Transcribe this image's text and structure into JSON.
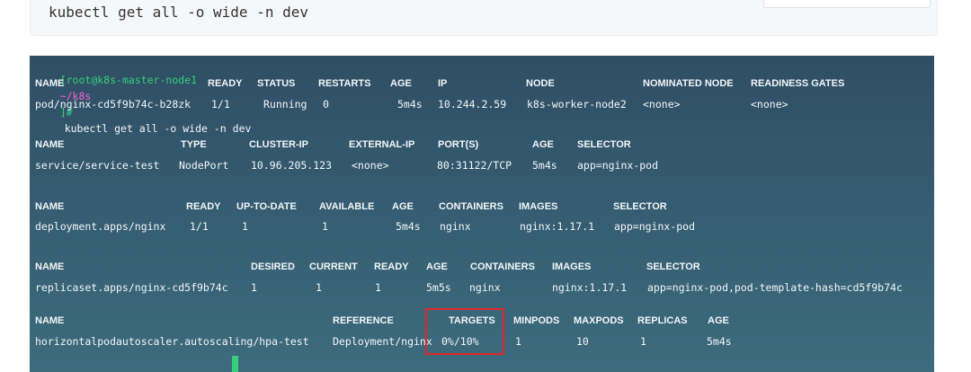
{
  "code": {
    "command": "kubectl get all -o wide -n dev"
  },
  "prompt": {
    "user_host": "[root@k8s-master-node1",
    "dir": "~/k8s",
    "suffix": "]#",
    "command": "kubectl get all -o wide -n dev"
  },
  "pods": {
    "headers": [
      "NAME",
      "READY",
      "STATUS",
      "RESTARTS",
      "AGE",
      "IP",
      "NODE",
      "NOMINATED NODE",
      "READINESS GATES"
    ],
    "rows": [
      [
        "pod/nginx-cd5f9b74c-b28zk",
        "1/1",
        "Running",
        "0",
        "5m4s",
        "10.244.2.59",
        "k8s-worker-node2",
        "<none>",
        "<none>"
      ]
    ]
  },
  "services": {
    "headers": [
      "NAME",
      "TYPE",
      "CLUSTER-IP",
      "EXTERNAL-IP",
      "PORT(S)",
      "AGE",
      "SELECTOR"
    ],
    "rows": [
      [
        "service/service-test",
        "NodePort",
        "10.96.205.123",
        "<none>",
        "80:31122/TCP",
        "5m4s",
        "app=nginx-pod"
      ]
    ]
  },
  "deployments": {
    "headers": [
      "NAME",
      "READY",
      "UP-TO-DATE",
      "AVAILABLE",
      "AGE",
      "CONTAINERS",
      "IMAGES",
      "SELECTOR"
    ],
    "rows": [
      [
        "deployment.apps/nginx",
        "1/1",
        "1",
        "1",
        "5m4s",
        "nginx",
        "nginx:1.17.1",
        "app=nginx-pod"
      ]
    ]
  },
  "replicasets": {
    "headers": [
      "NAME",
      "DESIRED",
      "CURRENT",
      "READY",
      "AGE",
      "CONTAINERS",
      "IMAGES",
      "SELECTOR"
    ],
    "rows": [
      [
        "replicaset.apps/nginx-cd5f9b74c",
        "1",
        "1",
        "1",
        "5m5s",
        "nginx",
        "nginx:1.17.1",
        "app=nginx-pod,pod-template-hash=cd5f9b74c"
      ]
    ]
  },
  "hpa": {
    "headers": [
      "NAME",
      "REFERENCE",
      "TARGETS",
      "MINPODS",
      "MAXPODS",
      "REPLICAS",
      "AGE"
    ],
    "rows": [
      [
        "horizontalpodautoscaler.autoscaling/hpa-test",
        "Deployment/nginx",
        "0%/10%",
        "1",
        "10",
        "1",
        "5m4s"
      ]
    ]
  },
  "colors": {
    "prompt_user": "#36d17a",
    "prompt_dir": "#ff5fd2",
    "highlight": "#e0262b",
    "terminal_bg": "#345a70"
  }
}
